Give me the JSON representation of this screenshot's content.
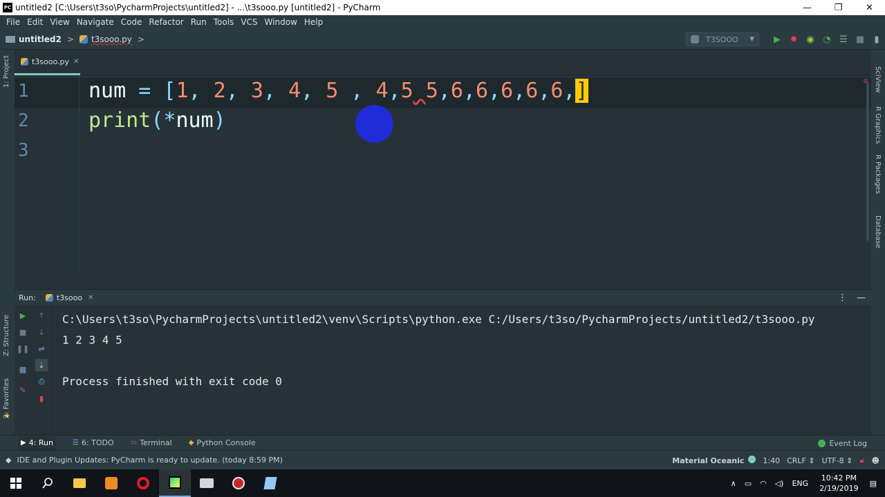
{
  "window": {
    "logo": "PC",
    "title": "untitled2 [C:\\Users\\t3so\\PycharmProjects\\untitled2] - ...\\t3sooo.py [untitled2] - PyCharm",
    "controls": {
      "minimize": "—",
      "maximize": "❐",
      "close": "✕"
    }
  },
  "menu": {
    "items": [
      "File",
      "Edit",
      "View",
      "Navigate",
      "Code",
      "Refactor",
      "Run",
      "Tools",
      "VCS",
      "Window",
      "Help"
    ]
  },
  "navbar": {
    "project": "untitled2",
    "separator": ">",
    "file": "t3sooo.py",
    "run_config": "T3SOOO"
  },
  "left_tabs": {
    "project": "1: Project",
    "structure": "Z: Structure",
    "favorites": "2: Favorites"
  },
  "right_tabs": {
    "sciview": "SciView",
    "r_graphics": "R Graphics",
    "r_packages": "R Packages",
    "database": "Database"
  },
  "editor": {
    "tab_label": "t3sooo.py",
    "line_numbers": [
      "1",
      "2",
      "3"
    ],
    "line1": {
      "ident": "num",
      "eq": "=",
      "open": "[",
      "nums": [
        "1",
        "2",
        "3",
        "4",
        "5",
        "4",
        "5",
        "5",
        "6",
        "6",
        "6",
        "6",
        "6"
      ],
      "close": "]"
    },
    "line2": {
      "fn": "print",
      "open": "(",
      "star": "*",
      "arg": "num",
      "close": ")"
    }
  },
  "run_panel": {
    "label": "Run:",
    "tab": "t3sooo",
    "console": {
      "command": "C:\\Users\\t3so\\PycharmProjects\\untitled2\\venv\\Scripts\\python.exe C:/Users/t3so/PycharmProjects/untitled2/t3sooo.py",
      "output": "1 2 3 4 5",
      "finish": "Process finished with exit code 0"
    }
  },
  "bottom_tabs": {
    "run": "4: Run",
    "todo": "6: TODO",
    "terminal": "Terminal",
    "python_console": "Python Console",
    "event_log": "Event Log"
  },
  "status": {
    "message": "IDE and Plugin Updates: PyCharm is ready to update. (today 8:59 PM)",
    "theme": "Material Oceanic",
    "position": "1:40",
    "line_sep": "CRLF ⇕",
    "encoding": "UTF-8 ⇕"
  },
  "taskbar": {
    "lang": "ENG",
    "time": "10:42 PM",
    "date": "2/19/2019"
  },
  "colors": {
    "editor_bg": "#263238",
    "number": "#f78c6c",
    "function": "#c3e88d",
    "accent": "#80cbc4",
    "cursor": "#ffcc00"
  }
}
